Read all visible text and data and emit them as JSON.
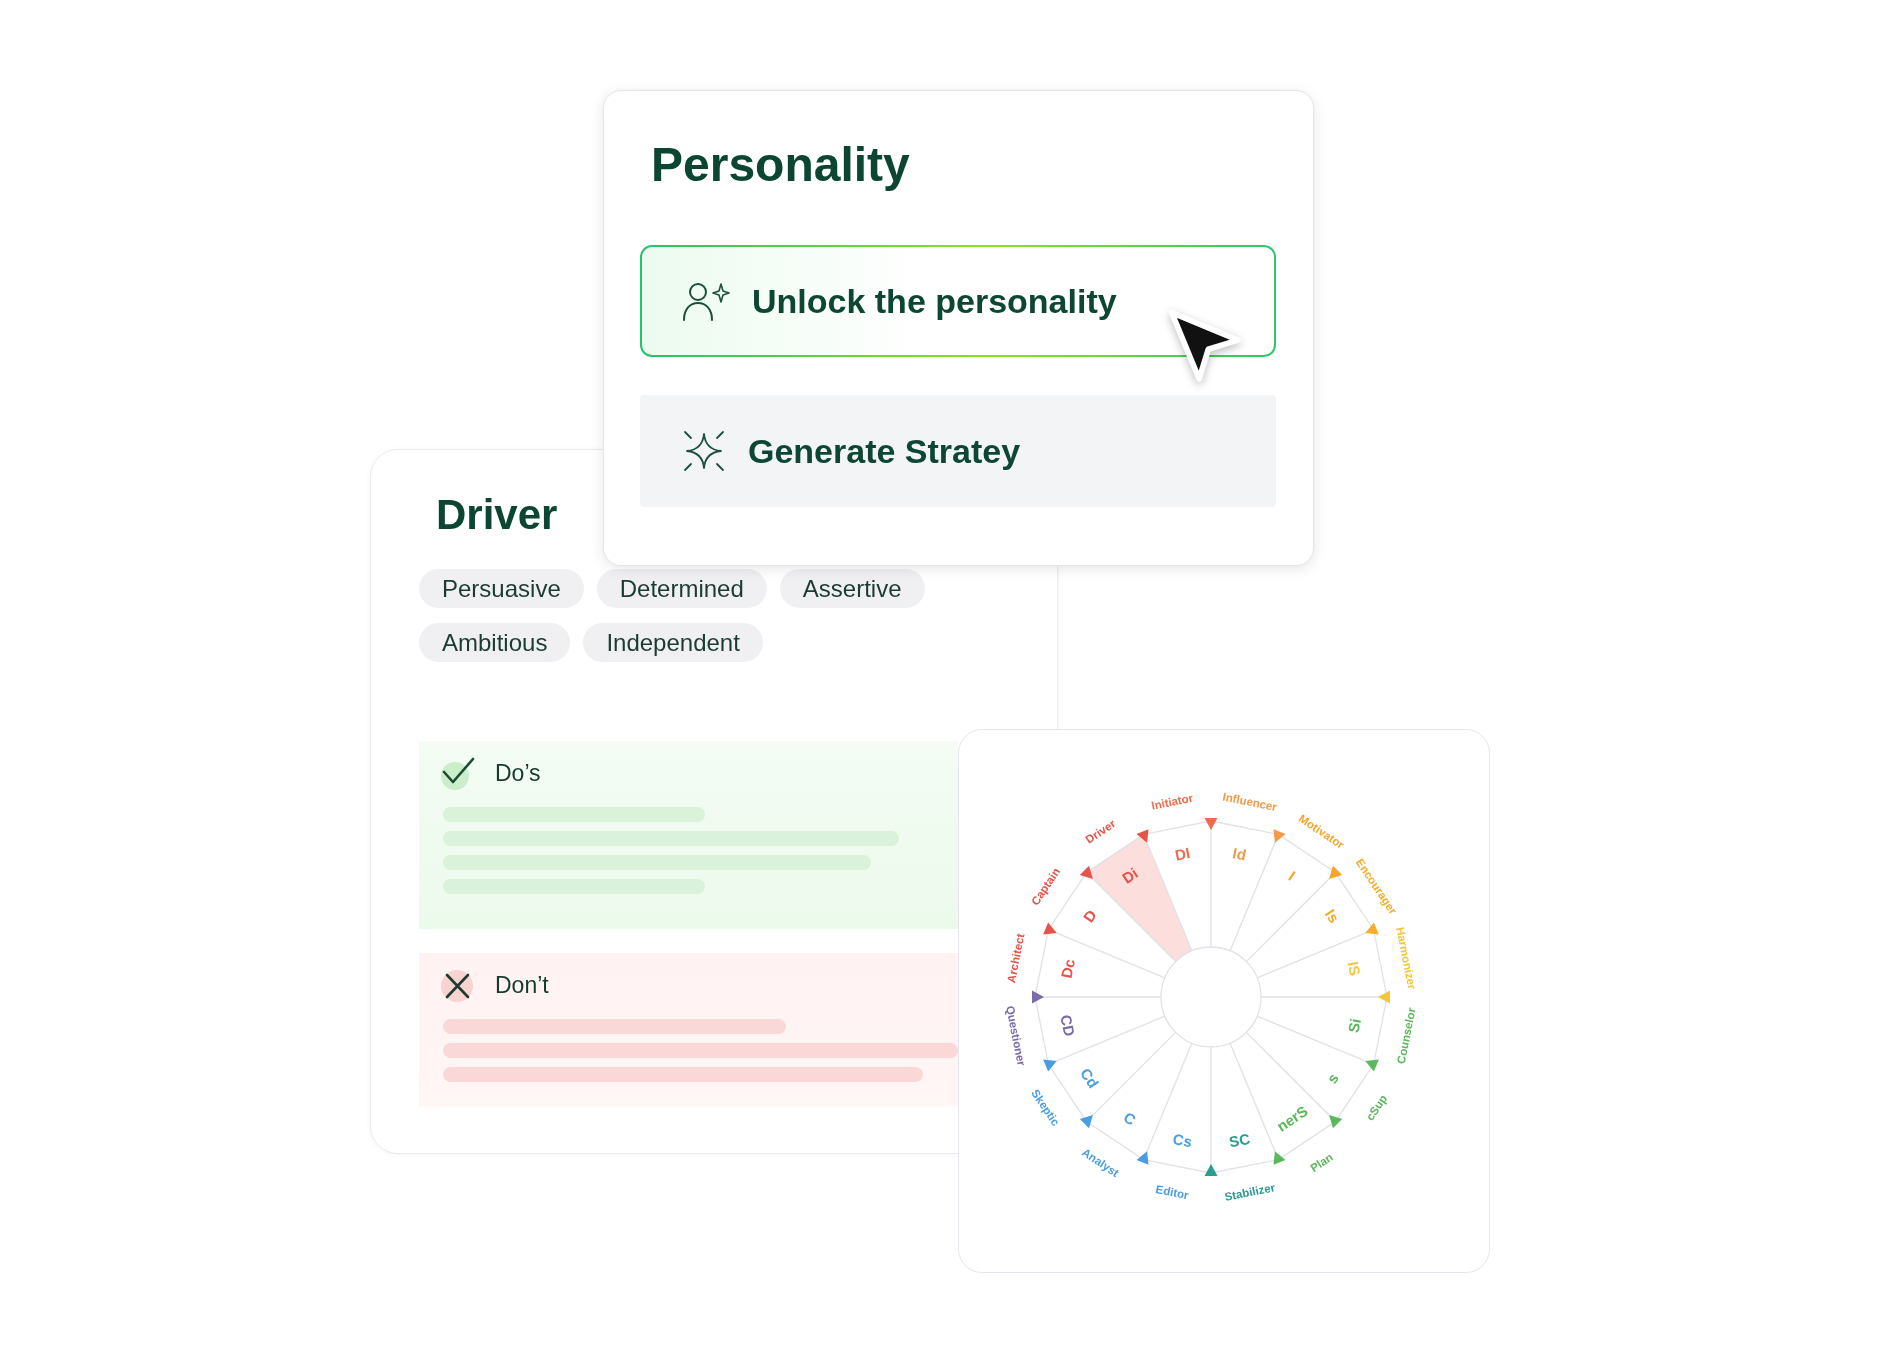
{
  "personality_card": {
    "title": "Personality",
    "actions": [
      {
        "kind": "unlock",
        "label": "Unlock the personality",
        "highlighted": true
      },
      {
        "kind": "generate",
        "label": "Generate Stratey",
        "highlighted": false
      }
    ]
  },
  "profile_card": {
    "title": "Driver",
    "traits": [
      "Persuasive",
      "Determined",
      "Assertive",
      "Ambitious",
      "Independent"
    ],
    "guidelines": [
      {
        "kind": "do",
        "label": "Do’s"
      },
      {
        "kind": "dont",
        "label": "Don’t"
      }
    ]
  },
  "wheel": {
    "segments": [
      {
        "code": "DI",
        "name": "Initiator",
        "color": "#ee6c4d",
        "selected": false
      },
      {
        "code": "Id",
        "name": "Influencer",
        "color": "#f29a4a",
        "selected": false
      },
      {
        "code": "I",
        "name": "Motivator",
        "color": "#f5a52a",
        "selected": false
      },
      {
        "code": "Is",
        "name": "Encourager",
        "color": "#f5ad2a",
        "selected": false
      },
      {
        "code": "IS",
        "name": "Harmonizer",
        "color": "#f5c53a",
        "selected": false
      },
      {
        "code": "Si",
        "name": "Counselor",
        "color": "#5cb85c",
        "selected": false
      },
      {
        "code": "s",
        "name": "cSup",
        "color": "#5cb85c",
        "selected": false
      },
      {
        "code": "nerS",
        "name": "Plan",
        "color": "#5cb85c",
        "selected": false
      },
      {
        "code": "SC",
        "name": "Stabilizer",
        "color": "#2a9d8f",
        "selected": false
      },
      {
        "code": "Cs",
        "name": "Editor",
        "color": "#4a9de0",
        "selected": false
      },
      {
        "code": "C",
        "name": "Analyst",
        "color": "#4a9de0",
        "selected": false
      },
      {
        "code": "Cd",
        "name": "Skeptic",
        "color": "#4a9de0",
        "selected": false
      },
      {
        "code": "CD",
        "name": "Questioner",
        "color": "#7a6aa8",
        "selected": false
      },
      {
        "code": "Dc",
        "name": "Architect",
        "color": "#e5534b",
        "selected": false
      },
      {
        "code": "D",
        "name": "Captain",
        "color": "#e5534b",
        "selected": false
      },
      {
        "code": "Di",
        "name": "Driver",
        "color": "#e5534b",
        "selected": true
      }
    ]
  }
}
